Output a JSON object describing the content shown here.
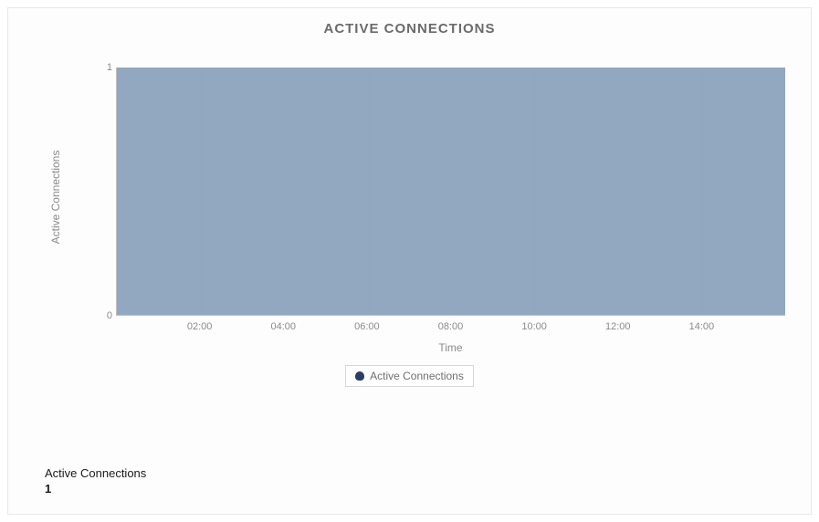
{
  "chart_data": {
    "type": "area",
    "title": "ACTIVE CONNECTIONS",
    "xlabel": "Time",
    "ylabel": "Active Connections",
    "ylim": [
      0,
      1
    ],
    "y_ticks": [
      "0",
      "1"
    ],
    "x_ticks": [
      "02:00",
      "04:00",
      "06:00",
      "08:00",
      "10:00",
      "12:00",
      "14:00"
    ],
    "series": [
      {
        "name": "Active Connections",
        "color": "#8ca2bd",
        "constant_value": 1
      }
    ],
    "legend": {
      "label": "Active Connections"
    }
  },
  "summary": {
    "label": "Active Connections",
    "value": "1"
  }
}
